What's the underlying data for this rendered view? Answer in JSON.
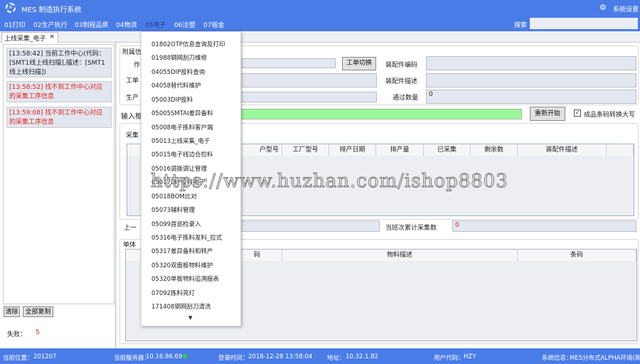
{
  "app": {
    "title": "MES 制造执行系统",
    "settings": "系统设置",
    "logo_text": "MES"
  },
  "nav": {
    "items": [
      "01打印",
      "02生产执行",
      "03制程品质",
      "04物流",
      "05电子",
      "06注塑",
      "07钣金"
    ],
    "search_label": "搜索"
  },
  "tab": {
    "label": "上线采集_电子",
    "close": "×"
  },
  "log": [
    {
      "text": "[13:58:42] 当前工作中心(代码：[SMT1线上线扫描],描述：[SMT1线上线扫描])",
      "type": "info"
    },
    {
      "text": "[13:58:52] 找不到工作中心对应的采集工序信息",
      "type": "error"
    },
    {
      "text": "[13:59:08] 找不到工作中心对应的采集工序信息",
      "type": "error"
    }
  ],
  "left_buttons": {
    "clear": "清除",
    "copy_all": "全部复制"
  },
  "fail": {
    "label": "失败：",
    "value": "5"
  },
  "form": {
    "group_title": "附属信",
    "label_zuo": "作",
    "label_order": "工单",
    "label_prod": "生产",
    "switch_order": "工单切换",
    "assembly_code_label": "装配件编码",
    "assembly_desc_label": "装配件描述",
    "pass_count_label": "通过数量",
    "pass_count_value": "0",
    "input_label": "输入框",
    "restart": "重新开始",
    "uppercase_label": "成品条码转换大写",
    "uppercase_checked": true
  },
  "collect": {
    "title": "采集",
    "headers": [
      "户型号",
      "工厂型号",
      "排产日期",
      "排产量",
      "已采集",
      "剩余数",
      "装配件描述"
    ]
  },
  "last": {
    "label": "上一",
    "shift_count_label": "当班次累计采集数",
    "shift_count_value": "0"
  },
  "single": {
    "title": "单体",
    "headers": [
      "码",
      "物料描述",
      "条码"
    ]
  },
  "dropdown": {
    "items": [
      "01802OTP信息查询及打印",
      "01988钢网刮刀维修",
      "04055DIP投料查询",
      "04058替代料维护",
      "05003DIP投料",
      "05005SMTAI差异备料",
      "05008电子拣料客户端",
      "05013上线采集_电子",
      "05015电子线边仓捡料",
      "05016调拨调让管理",
      "05017DIP投料电子",
      "05018BOM比对",
      "05073辅料管理",
      "05099首巡检录入",
      "05316电子拣料发料_拉式",
      "05317差异备料和转产",
      "05320双面板物料维护",
      "05320单板物料追溯报表",
      "07092拣料亮灯",
      "171408钢网刮刀清洗"
    ]
  },
  "status": {
    "location_label": "当前位置：",
    "location": "201207",
    "server_label": "当前服务器：",
    "server": "10.16.86.69",
    "login_label": "登录时间：",
    "login_time": "2018-12-28 13:58:04",
    "addr_label": "地址：",
    "addr": "10.32.1.82",
    "user_label": "用户代码：",
    "user": "HZY",
    "sys_label": "系统信息：",
    "sys": "MES分布式ALPHA环境(新話"
  },
  "watermark": "https://www.huzhan.com/ishop8803"
}
